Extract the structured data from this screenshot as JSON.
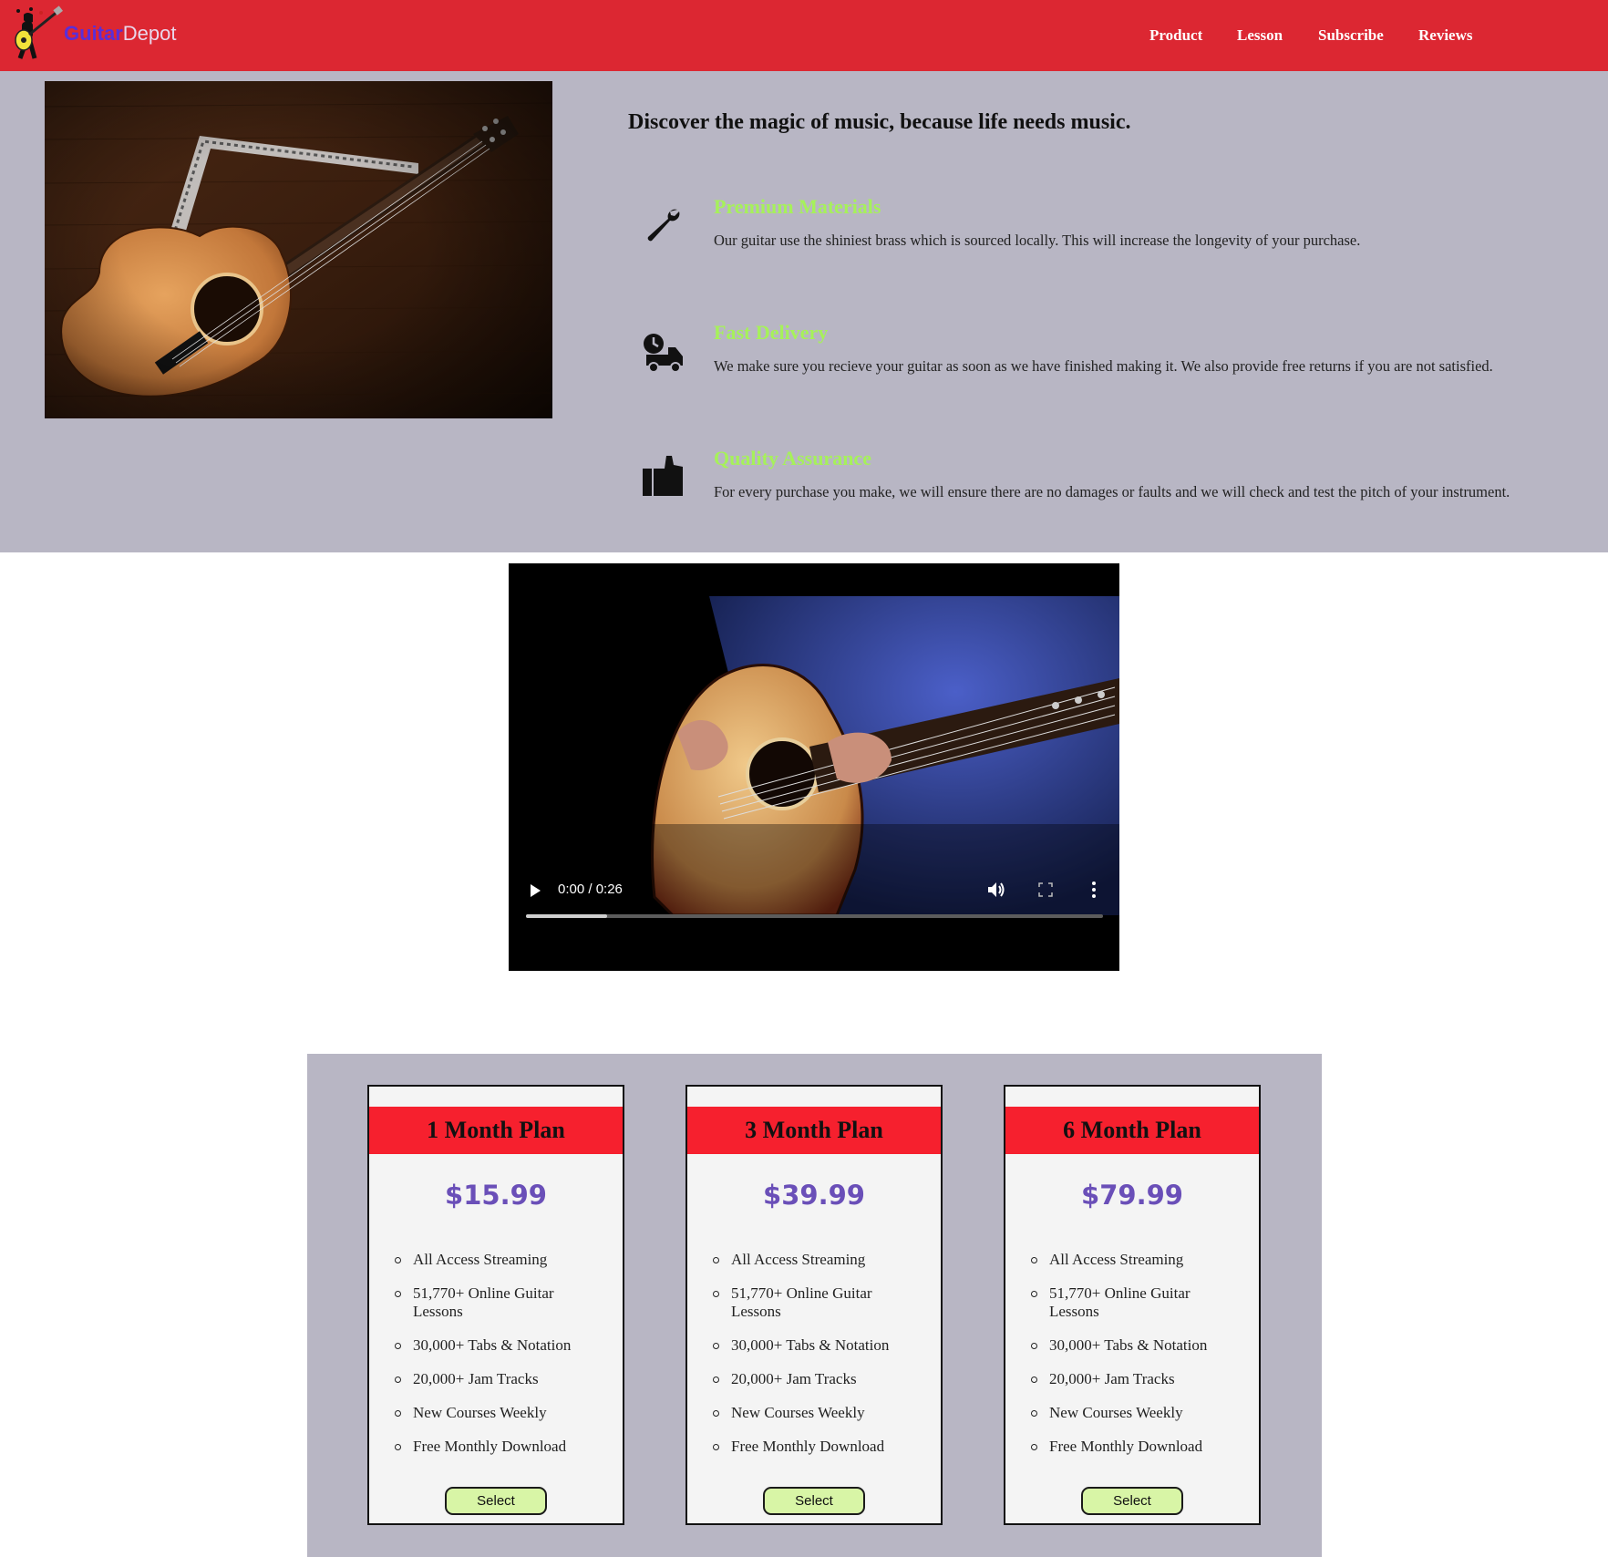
{
  "header": {
    "brand_part1": "Guitar",
    "brand_part2": "Depot",
    "nav": [
      "Product",
      "Lesson",
      "Subscribe",
      "Reviews"
    ]
  },
  "hero": {
    "tagline": "Discover the magic of music, because life needs music.",
    "features": [
      {
        "icon": "wrench-icon",
        "title": "Premium Materials",
        "text": "Our guitar use the shiniest brass which is sourced locally. This will increase the longevity of your purchase."
      },
      {
        "icon": "delivery-truck-icon",
        "title": "Fast Delivery",
        "text": "We make sure you recieve your guitar as soon as we have finished making it. We also provide free returns if you are not satisfied."
      },
      {
        "icon": "thumbs-up-icon",
        "title": "Quality Assurance",
        "text": "For every purchase you make, we will ensure there are no damages or faults and we will check and test the pitch of your instrument."
      }
    ]
  },
  "video": {
    "time": "0:00 / 0:26",
    "buffered_fraction": 0.14
  },
  "plans": [
    {
      "name": "1 Month Plan",
      "price": "$15.99",
      "features": [
        "All Access Streaming",
        "51,770+ Online Guitar Lessons",
        "30,000+ Tabs & Notation",
        "20,000+ Jam Tracks",
        "New Courses Weekly",
        "Free Monthly Download"
      ],
      "button": "Select"
    },
    {
      "name": "3 Month Plan",
      "price": "$39.99",
      "features": [
        "All Access Streaming",
        "51,770+ Online Guitar Lessons",
        "30,000+ Tabs & Notation",
        "20,000+ Jam Tracks",
        "New Courses Weekly",
        "Free Monthly Download"
      ],
      "button": "Select"
    },
    {
      "name": "6 Month Plan",
      "price": "$79.99",
      "features": [
        "All Access Streaming",
        "51,770+ Online Guitar Lessons",
        "30,000+ Tabs & Notation",
        "20,000+ Jam Tracks",
        "New Courses Weekly",
        "Free Monthly Download"
      ],
      "button": "Select"
    }
  ],
  "colors": {
    "nav_bg": "#dc2732",
    "section_bg": "#b8b6c4",
    "feature_title": "#a6f15a",
    "plan_header": "#f6202e",
    "price": "#6a4fb8",
    "button_bg": "#d8f5a6"
  }
}
